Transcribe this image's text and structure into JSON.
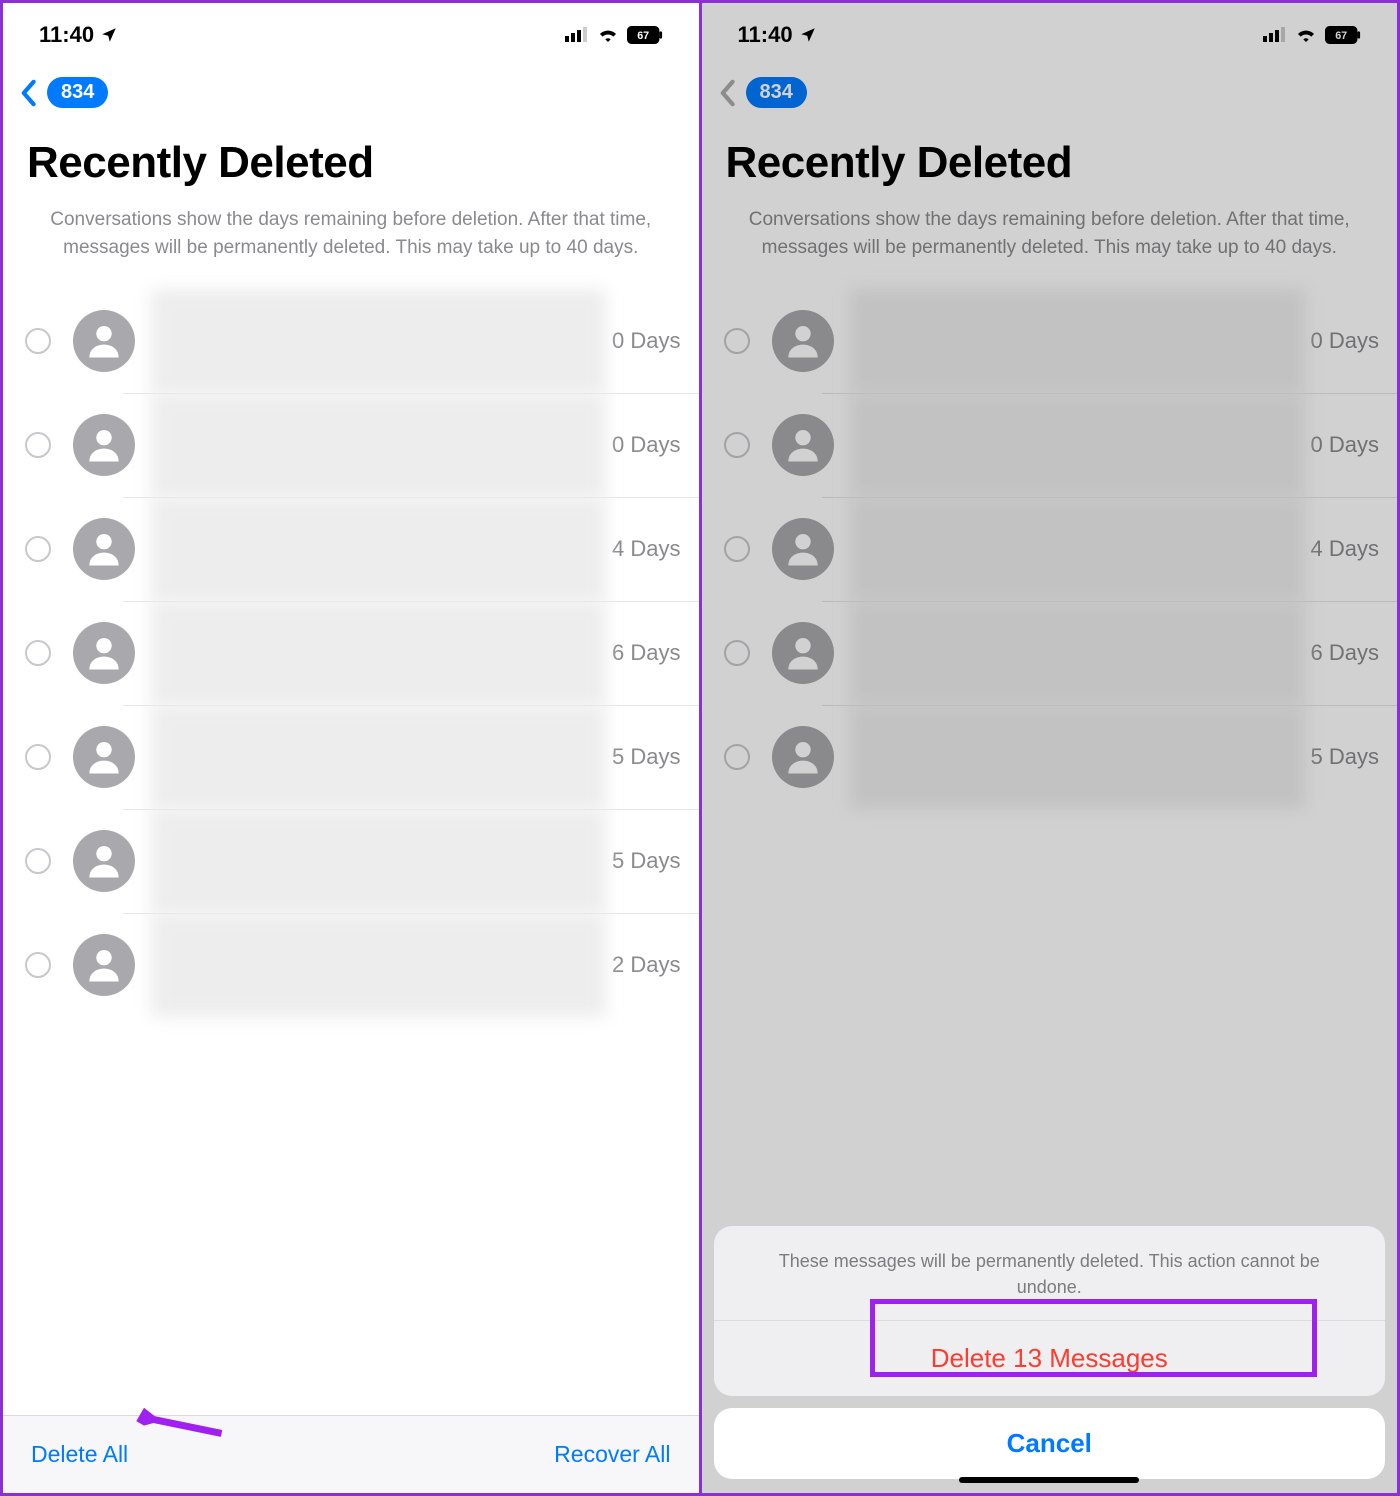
{
  "status": {
    "time": "11:40",
    "battery": "67"
  },
  "nav": {
    "back_badge": "834"
  },
  "header": {
    "title": "Recently Deleted",
    "subtitle": "Conversations show the days remaining before deletion. After that time, messages will be permanently deleted. This may take up to 40 days."
  },
  "left": {
    "rows": [
      {
        "days": "0 Days"
      },
      {
        "days": "0 Days"
      },
      {
        "days": "4 Days"
      },
      {
        "days": "6 Days"
      },
      {
        "days": "5 Days"
      },
      {
        "days": "5 Days"
      },
      {
        "days": "2 Days"
      }
    ],
    "toolbar": {
      "delete_all": "Delete All",
      "recover_all": "Recover All"
    }
  },
  "right": {
    "rows": [
      {
        "days": "0 Days"
      },
      {
        "days": "0 Days"
      },
      {
        "days": "4 Days"
      },
      {
        "days": "6 Days"
      },
      {
        "days": "5 Days"
      }
    ],
    "sheet": {
      "message": "These messages will be permanently deleted. This action cannot be undone.",
      "delete_label": "Delete 13 Messages",
      "cancel_label": "Cancel"
    }
  }
}
